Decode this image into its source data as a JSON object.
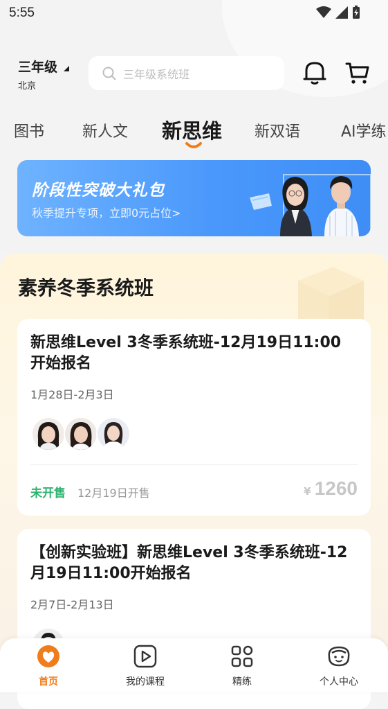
{
  "status_bar": {
    "time": "5:55"
  },
  "header": {
    "grade": "三年级",
    "city": "北京",
    "search_placeholder": "三年级系统班"
  },
  "tabs": [
    {
      "label": "图书",
      "active": false
    },
    {
      "label": "新人文",
      "active": false
    },
    {
      "label": "新思维",
      "active": true
    },
    {
      "label": "新双语",
      "active": false
    },
    {
      "label": "AI学练",
      "active": false
    }
  ],
  "banner": {
    "title": "阶段性突破大礼包",
    "subtitle": "秋季提升专项，立即0元占位>"
  },
  "section": {
    "title": "素养冬季系统班"
  },
  "courses": [
    {
      "title": "新思维Level 3冬季系统班-12月19日11:00开始报名",
      "date": "1月28日-2月3日",
      "status": "未开售",
      "sale_time": "12月19日开售",
      "currency": "¥",
      "price": "1260"
    },
    {
      "title": "【创新实验班】新思维Level 3冬季系统班-12月19日11:00开始报名",
      "date": "2月7日-2月13日"
    }
  ],
  "bottom_nav": [
    {
      "label": "首页",
      "icon": "home-icon",
      "active": true
    },
    {
      "label": "我的课程",
      "icon": "play-icon",
      "active": false
    },
    {
      "label": "精练",
      "icon": "grid-icon",
      "active": false
    },
    {
      "label": "个人中心",
      "icon": "profile-icon",
      "active": false
    }
  ],
  "colors": {
    "accent": "#f07d1c",
    "status_green": "#2db36f",
    "banner_blue": "#4a98fb"
  }
}
